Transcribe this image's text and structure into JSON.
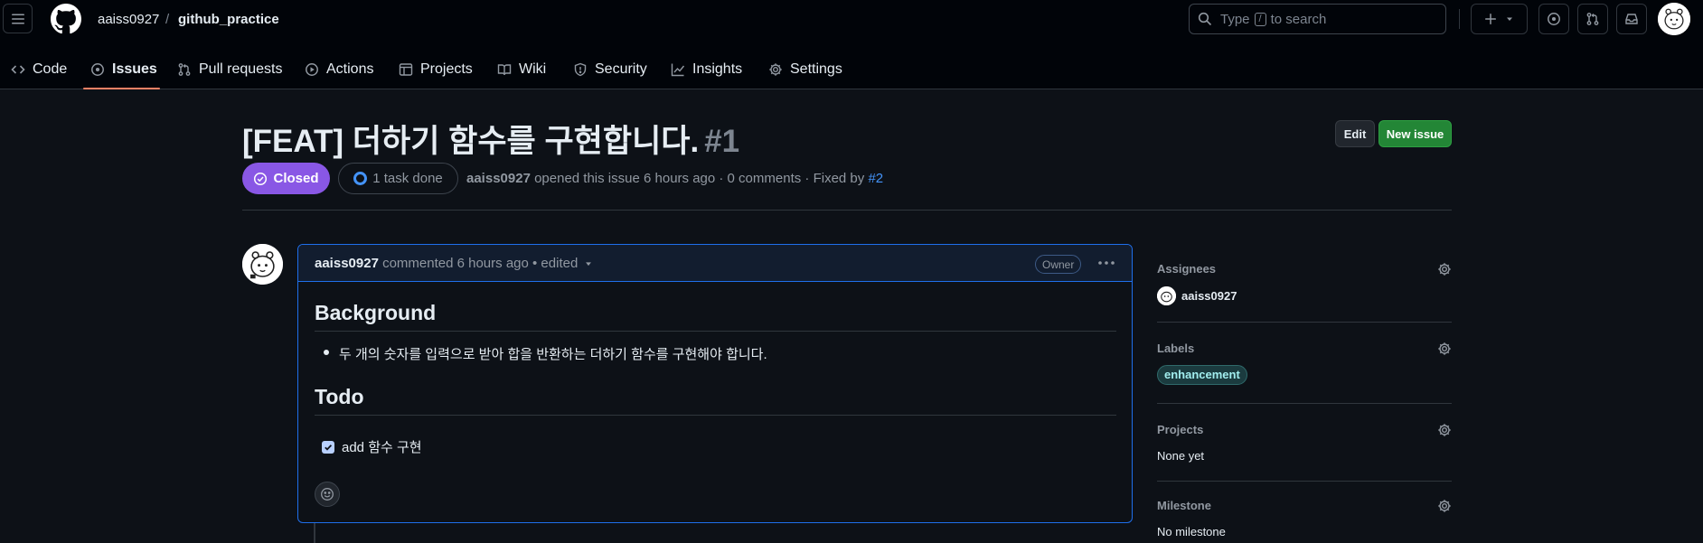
{
  "header": {
    "owner": "aaiss0927",
    "separator": "/",
    "repo": "github_practice",
    "search": {
      "prefix": "Type",
      "key": "/",
      "suffix": "to search"
    },
    "icons": [
      "hamburger-icon",
      "github-logo",
      "plus-icon",
      "issue-icon",
      "pull-request-icon",
      "inbox-icon"
    ]
  },
  "tabs": [
    {
      "label": "Code",
      "icon": "code-icon"
    },
    {
      "label": "Issues",
      "icon": "issue-icon",
      "active": true
    },
    {
      "label": "Pull requests",
      "icon": "pull-request-icon"
    },
    {
      "label": "Actions",
      "icon": "play-icon"
    },
    {
      "label": "Projects",
      "icon": "table-icon"
    },
    {
      "label": "Wiki",
      "icon": "book-icon"
    },
    {
      "label": "Security",
      "icon": "shield-icon"
    },
    {
      "label": "Insights",
      "icon": "graph-icon"
    },
    {
      "label": "Settings",
      "icon": "gear-icon"
    }
  ],
  "issue": {
    "title": "[FEAT] 더하기 함수를 구현합니다.",
    "number": "#1",
    "edit_label": "Edit",
    "new_issue_label": "New issue",
    "state": "Closed",
    "tasks": "1 task done",
    "meta": {
      "author": "aaiss0927",
      "opened": "opened this issue 6 hours ago · 0 comments · Fixed by",
      "fixed_by": "#2"
    }
  },
  "comment": {
    "author": "aaiss0927",
    "time": "commented 6 hours ago • edited",
    "badge": "Owner",
    "background_heading": "Background",
    "bullet": "두 개의 숫자를 입력으로 받아 합을 반환하는 더하기 함수를 구현해야 합니다.",
    "todo_heading": "Todo",
    "task": {
      "label": "add 함수 구현",
      "checked": true
    }
  },
  "sidebar": {
    "assignees": {
      "label": "Assignees",
      "value": "aaiss0927"
    },
    "labels": {
      "label": "Labels",
      "chip": "enhancement"
    },
    "projects": {
      "label": "Projects",
      "value": "None yet"
    },
    "milestone": {
      "label": "Milestone",
      "value": "No milestone"
    }
  },
  "colors": {
    "background": "#0d1117",
    "header": "#010409",
    "closed": "#8957e5",
    "primary": "#238636",
    "link": "#4493f8",
    "tab_underline": "#f78166",
    "label_fg": "#a2eeef"
  }
}
